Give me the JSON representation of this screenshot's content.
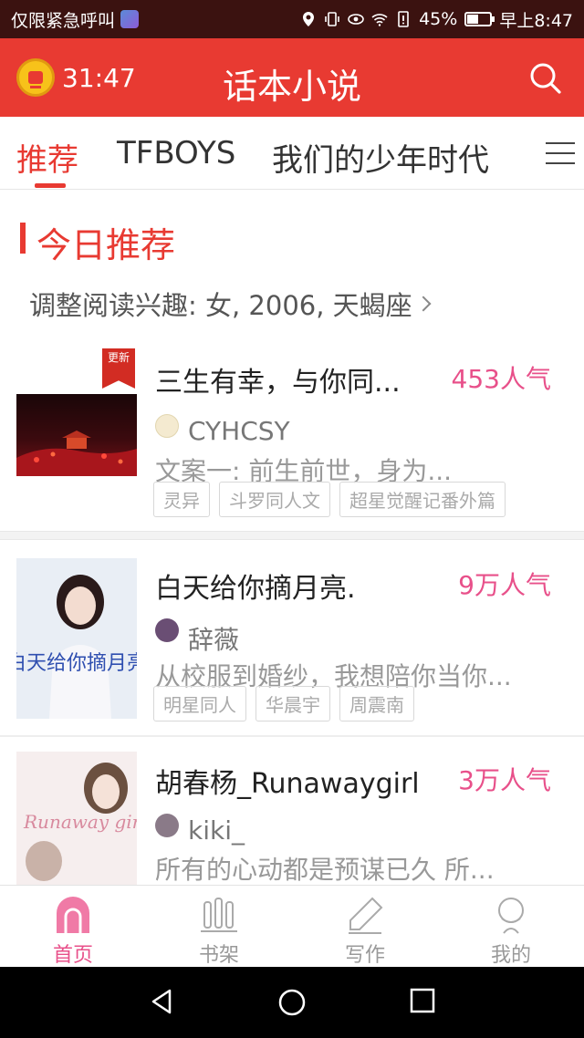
{
  "status_bar": {
    "left_text": "仅限紧急呼叫",
    "battery": "45%",
    "time": "早上8:47"
  },
  "header": {
    "timer": "31:47",
    "title": "话本小说"
  },
  "tabs": [
    {
      "label": "推荐"
    },
    {
      "label": "TFBOYS"
    },
    {
      "label": "我们的少年时代"
    }
  ],
  "section": {
    "title": "今日推荐",
    "preference": "调整阅读兴趣: 女, 2006, 天蝎座"
  },
  "books": [
    {
      "badge": "更新",
      "title": "三生有幸，与你同...",
      "popularity": "453人气",
      "author": "CYHCSY",
      "description": "文案一:      前生前世，身为...",
      "tags": [
        "灵异",
        "斗罗同人文",
        "超星觉醒记番外篇"
      ]
    },
    {
      "title": "白天给你摘月亮.",
      "popularity": "9万人气",
      "author": "辞薇",
      "description": "从校服到婚纱，我想陪你当你...",
      "tags": [
        "明星同人",
        "华晨宇",
        "周震南"
      ],
      "cover_text": "白天给你摘月亮"
    },
    {
      "title": "胡春杨_Runawaygirl",
      "popularity": "3万人气",
      "author": "kiki_",
      "description": "所有的心动都是预谋已久  所...",
      "tags": [],
      "cover_text": "Runaway girl"
    }
  ],
  "bottom_nav": [
    {
      "label": "首页",
      "icon": "home-icon"
    },
    {
      "label": "书架",
      "icon": "bookshelf-icon"
    },
    {
      "label": "写作",
      "icon": "pen-icon"
    },
    {
      "label": "我的",
      "icon": "profile-icon"
    }
  ],
  "colors": {
    "header_red": "#e83a32",
    "popularity_pink": "#e8508a"
  }
}
